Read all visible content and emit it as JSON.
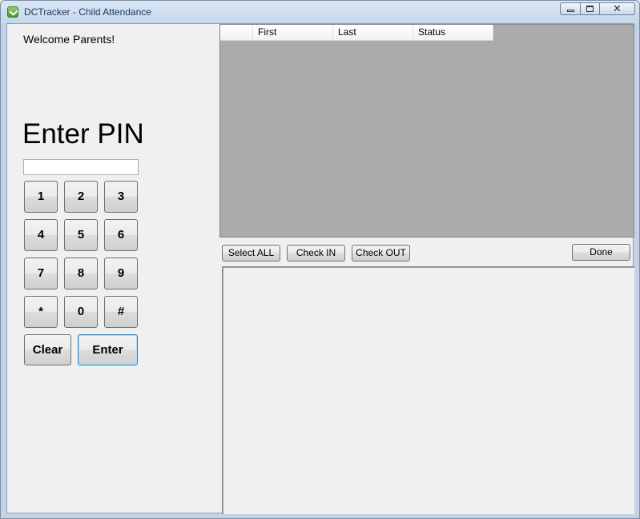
{
  "window": {
    "title": "DCTracker - Child Attendance"
  },
  "left": {
    "welcome": "Welcome Parents!",
    "enter_pin": "Enter PIN",
    "pin_value": "",
    "keys": [
      "1",
      "2",
      "3",
      "4",
      "5",
      "6",
      "7",
      "8",
      "9",
      "*",
      "0",
      "#"
    ],
    "clear_label": "Clear",
    "enter_label": "Enter"
  },
  "grid": {
    "columns": [
      "First",
      "Last",
      "Status"
    ],
    "rows": []
  },
  "actions": {
    "select_all": "Select ALL",
    "check_in": "Check IN",
    "check_out": "Check OUT",
    "done": "Done"
  },
  "colors": {
    "grid_background": "#ababab",
    "form_background": "#f0f0f0",
    "enter_button_border": "#3c7fb1"
  }
}
